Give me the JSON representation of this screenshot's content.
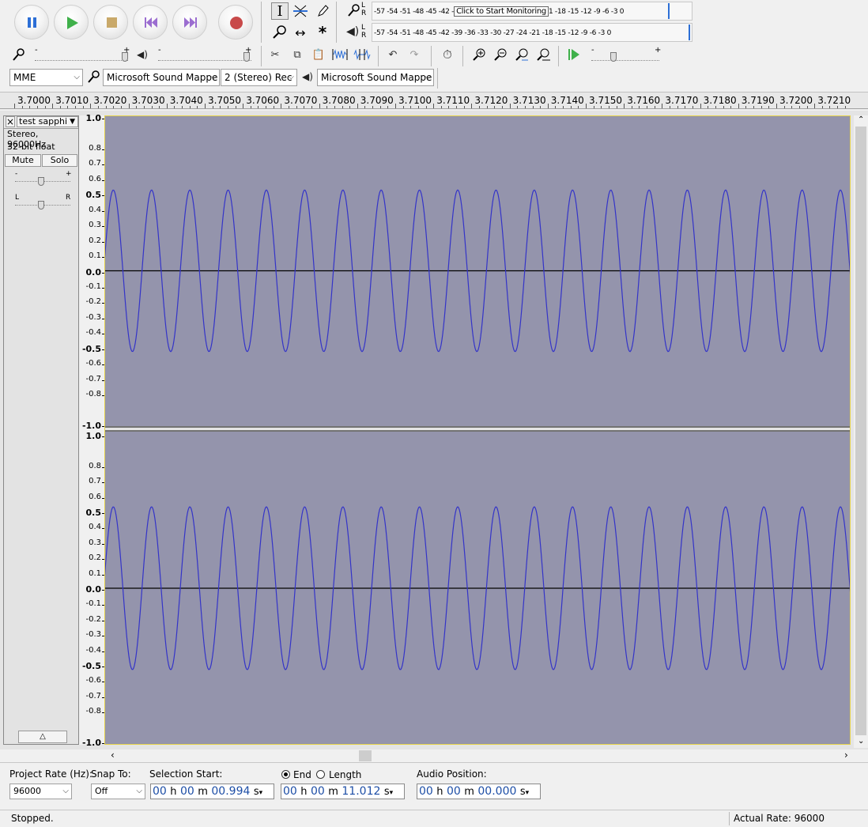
{
  "transport": {
    "buttons": [
      {
        "name": "pause-button",
        "icon": "pause-icon",
        "color": "#2d6fd6"
      },
      {
        "name": "play-button",
        "icon": "play-icon",
        "color": "#3fb04a"
      },
      {
        "name": "stop-button",
        "icon": "stop-icon",
        "color": "#c9a96a"
      },
      {
        "name": "skip-to-start-button",
        "icon": "skip-start-icon",
        "color": "#9b6dd0"
      },
      {
        "name": "skip-to-end-button",
        "icon": "skip-end-icon",
        "color": "#9b6dd0"
      },
      {
        "name": "record-button",
        "icon": "record-icon",
        "color": "#c84a4a"
      }
    ]
  },
  "meters": {
    "record_scale": "-57 -54 -51 -48 -45 -42 -",
    "record_scale_tail": "1 -18 -15 -12  -9  -6  -3  0",
    "record_tooltip": "Click to Start Monitoring",
    "playback_scale": "-57 -54 -51 -48 -45 -42 -39 -36 -33 -30 -27 -24 -21 -18 -15 -12  -9  -6  -3  0",
    "channel_l": "L",
    "channel_r": "R"
  },
  "mixer": {
    "minus": "-",
    "plus": "+"
  },
  "device": {
    "host": "MME",
    "recording_device": "Microsoft Sound Mappe",
    "channels": "2 (Stereo) Rec",
    "playback_device": "Microsoft Sound Mappe"
  },
  "ruler": {
    "labels": [
      "3.7000",
      "3.7010",
      "3.7020",
      "3.7030",
      "3.7040",
      "3.7050",
      "3.7060",
      "3.7070",
      "3.7080",
      "3.7090",
      "3.7100",
      "3.7110",
      "3.7120",
      "3.7130",
      "3.7140",
      "3.7150",
      "3.7160",
      "3.7170",
      "3.7180",
      "3.7190",
      "3.7200",
      "3.7210"
    ]
  },
  "track": {
    "name": "test sapphi",
    "close": "×",
    "format": "Stereo, 96000Hz",
    "bitdepth": "32-bit float",
    "mute": "Mute",
    "solo": "Solo",
    "gain_minus": "-",
    "gain_plus": "+",
    "pan_l": "L",
    "pan_r": "R",
    "waveform_color": "#3434c8",
    "background_color": "#9494ac",
    "amplitude": 0.52,
    "cycles_visible": 19.5
  },
  "amp_scale": {
    "labels": [
      "1.0",
      "0.8",
      "0.7",
      "0.6",
      "0.5",
      "0.4",
      "0.3",
      "0.2",
      "0.1",
      "0.0",
      "-0.1",
      "-0.2",
      "-0.3",
      "-0.4",
      "-0.5",
      "-0.6",
      "-0.7",
      "-0.8",
      "-1.0"
    ]
  },
  "selection": {
    "project_rate_label": "Project Rate (Hz):",
    "project_rate": "96000",
    "snap_to_label": "Snap To:",
    "snap_to": "Off",
    "selection_start_label": "Selection Start:",
    "end_label": "End",
    "length_label": "Length",
    "audio_position_label": "Audio Position:",
    "selection_start": {
      "h": "00",
      "m": "00",
      "s": "00.994"
    },
    "selection_end": {
      "h": "00",
      "m": "00",
      "s": "11.012"
    },
    "audio_position": {
      "h": "00",
      "m": "00",
      "s": "00.000"
    },
    "unit_h": "h",
    "unit_m": "m",
    "unit_s": "s"
  },
  "status": {
    "state": "Stopped.",
    "actual_rate": "Actual Rate: 96000"
  }
}
